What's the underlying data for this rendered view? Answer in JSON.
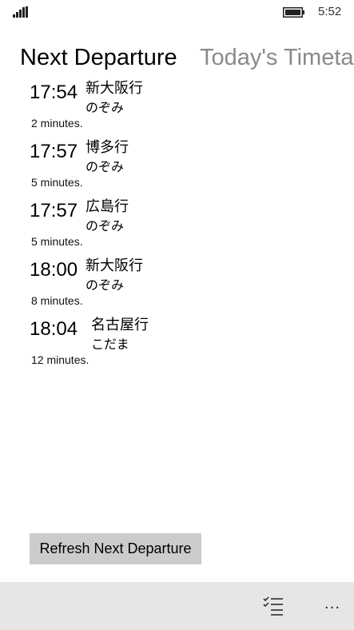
{
  "status_bar": {
    "time": "5:52",
    "signal_icon": "signal-strength-icon",
    "battery_icon": "battery-icon"
  },
  "pivot": {
    "tabs": [
      {
        "label": "Next Departure",
        "active": true
      },
      {
        "label": "Today's Timeta",
        "active": false
      }
    ]
  },
  "departures": [
    {
      "time": "17:54",
      "destination": "新大阪行",
      "train": "のぞみ",
      "wait": "2 minutes."
    },
    {
      "time": "17:57",
      "destination": "博多行",
      "train": "のぞみ",
      "wait": "5 minutes."
    },
    {
      "time": "17:57",
      "destination": "広島行",
      "train": "のぞみ",
      "wait": "5 minutes."
    },
    {
      "time": "18:00",
      "destination": "新大阪行",
      "train": "のぞみ",
      "wait": "8 minutes."
    },
    {
      "time": "18:04",
      "destination": "名古屋行",
      "train": "こだま",
      "wait": "12 minutes."
    }
  ],
  "refresh_button": {
    "label": "Refresh Next Departure"
  },
  "app_bar": {
    "select_icon": "select-list-icon",
    "more_label": "..."
  }
}
